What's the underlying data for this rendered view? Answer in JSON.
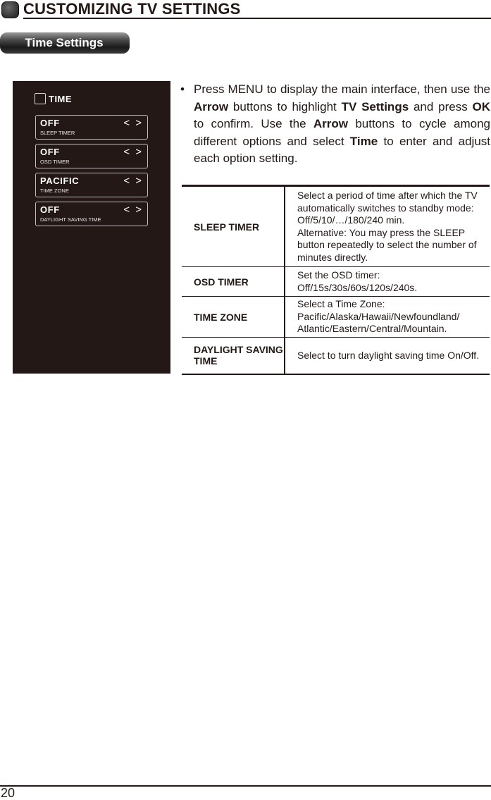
{
  "header": {
    "title": "CUSTOMIZING TV SETTINGS",
    "icon": "rounded-square-bullet"
  },
  "section": {
    "label": "Time Settings"
  },
  "tv_menu": {
    "title": "TIME",
    "items": [
      {
        "value": "OFF",
        "label": "SLEEP TIMER",
        "arrows": "< >"
      },
      {
        "value": "OFF",
        "label": "OSD TIMER",
        "arrows": "< >"
      },
      {
        "value": "PACIFIC",
        "label": "TIME ZONE",
        "arrows": "< >"
      },
      {
        "value": "OFF",
        "label": "DAYLIGHT SAVING TIME",
        "arrows": "< >"
      }
    ]
  },
  "instructions": {
    "bullet": "•",
    "parts": [
      "Press MENU to display the main interface, then use the ",
      "Arrow",
      " buttons to highlight ",
      "TV Settings",
      " and press ",
      "OK",
      " to confirm. Use the ",
      "Arrow",
      " buttons to cycle among different options and select ",
      "Time",
      " to enter and adjust each option setting."
    ]
  },
  "table": {
    "rows": [
      {
        "key": "SLEEP TIMER",
        "value": "Select a period of time after which the TV automatically switches to standby mode: Off/5/10/…/180/240 min.",
        "value2": "Alternative: You may press the SLEEP button repeatedly to select the number of minutes directly."
      },
      {
        "key": "OSD TIMER",
        "value": "Set the OSD timer:",
        "value2": "Off/15s/30s/60s/120s/240s."
      },
      {
        "key": "TIME ZONE",
        "value": "Select a Time Zone:",
        "value2": "Pacific/Alaska/Hawaii/Newfoundland/ Atlantic/Eastern/Central/Mountain."
      },
      {
        "key": "DAYLIGHT SAVING TIME",
        "value": "Select to turn daylight saving time On/Off.",
        "value2": ""
      }
    ]
  },
  "footer": {
    "page_number": "20"
  }
}
